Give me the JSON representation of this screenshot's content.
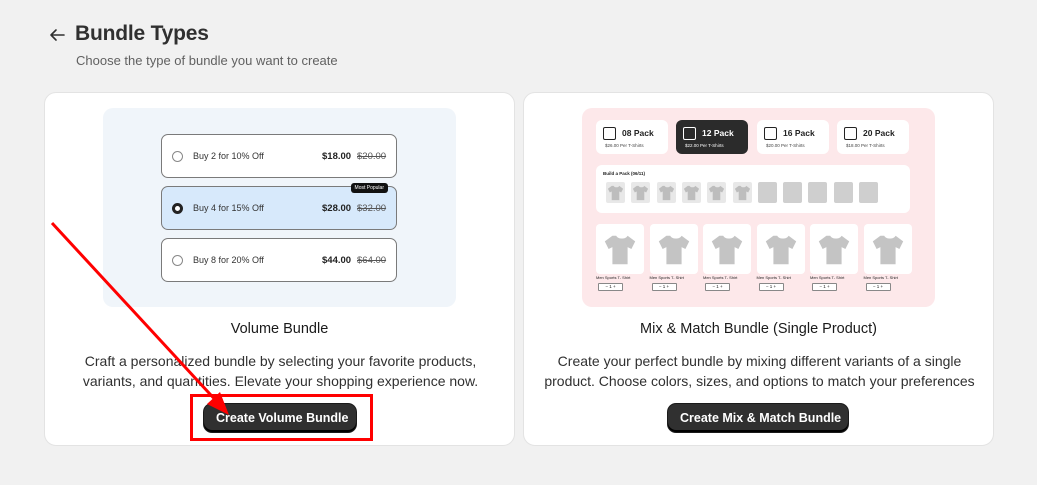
{
  "header": {
    "title": "Bundle Types",
    "subtitle": "Choose the type of bundle you want to create"
  },
  "volume_card": {
    "title": "Volume Bundle",
    "description": "Craft a personalized bundle by selecting your favorite products, variants, and quantities. Elevate your shopping experience now.",
    "button_label": "Create Volume Bundle",
    "tiers": [
      {
        "label": "Buy 2 for 10% Off",
        "price": "$18.00",
        "compare": "$20.00",
        "selected": false,
        "badge": ""
      },
      {
        "label": "Buy 4 for 15% Off",
        "price": "$28.00",
        "compare": "$32.00",
        "selected": true,
        "badge": "Most Popular"
      },
      {
        "label": "Buy 8 for 20% Off",
        "price": "$44.00",
        "compare": "$64.00",
        "selected": false,
        "badge": ""
      }
    ]
  },
  "mix_card": {
    "title": "Mix & Match Bundle (Single Product)",
    "description": "Create your perfect bundle by mixing different variants of a single product. Choose colors, sizes, and options to match your preferences",
    "button_label": "Create Mix & Match Bundle",
    "packs": [
      {
        "name": "08 Pack",
        "sub": "$26.00 Per T-Shirts",
        "selected": false
      },
      {
        "name": "12 Pack",
        "sub": "$22.00 Per T-Shirts",
        "selected": true
      },
      {
        "name": "16 Pack",
        "sub": "$20.00 Per T-Shirts",
        "selected": false
      },
      {
        "name": "20 Pack",
        "sub": "$18.00 Per T-Shirts",
        "selected": false
      }
    ],
    "builder_title": "Build a Pack (06/11)",
    "product_name": "Men Sports T- Shirt",
    "qty_text": "−  1  +"
  },
  "colors": {
    "annotation": "#ff0000",
    "button_bg": "#303030"
  }
}
